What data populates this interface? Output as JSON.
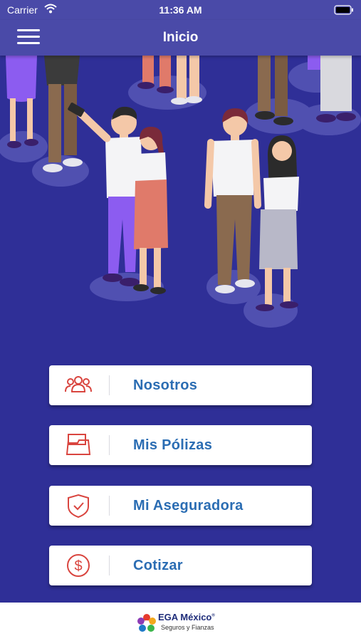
{
  "status_bar": {
    "carrier": "Carrier",
    "time": "11:36 AM"
  },
  "nav": {
    "title": "Inicio",
    "menu_icon": "hamburger-menu-icon"
  },
  "menu": {
    "items": [
      {
        "label": "Nosotros",
        "icon": "people-group-icon"
      },
      {
        "label": "Mis Pólizas",
        "icon": "folder-icon"
      },
      {
        "label": "Mi Aseguradora",
        "icon": "shield-check-icon"
      },
      {
        "label": "Cotizar",
        "icon": "dollar-circle-icon"
      }
    ]
  },
  "footer": {
    "brand": "EGA México",
    "trademark": "®",
    "tagline": "Seguros y Fianzas"
  },
  "colors": {
    "background": "#2f2f97",
    "nav": "#4a4aa8",
    "label": "#2b6db3",
    "icon": "#d9453f"
  }
}
